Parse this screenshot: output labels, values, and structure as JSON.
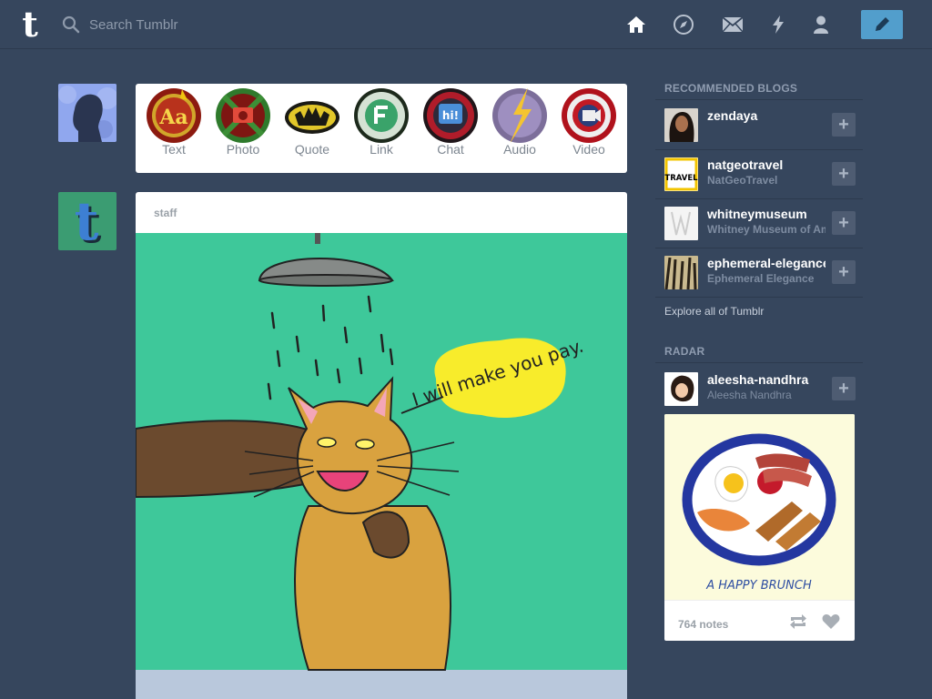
{
  "header": {
    "logo_letter": "t",
    "search_placeholder": "Search Tumblr",
    "nav_icons": [
      "home-icon",
      "explore-compass-icon",
      "inbox-mail-icon",
      "activity-lightning-icon",
      "account-person-icon"
    ],
    "compose_icon": "pencil-icon",
    "accent_color": "#529ecc",
    "background_color": "#36465d"
  },
  "post_types": [
    {
      "label": "Text"
    },
    {
      "label": "Photo"
    },
    {
      "label": "Quote"
    },
    {
      "label": "Link"
    },
    {
      "label": "Chat",
      "badge": "hi!"
    },
    {
      "label": "Audio"
    },
    {
      "label": "Video"
    }
  ],
  "post": {
    "author": "staff",
    "speech_bubble": "I will make you pay."
  },
  "sidebar": {
    "recommended_heading": "RECOMMENDED BLOGS",
    "blogs": [
      {
        "name": "zendaya",
        "title": ""
      },
      {
        "name": "natgeotravel",
        "title": "NatGeoTravel",
        "avatar_text": "TRAVEL"
      },
      {
        "name": "whitneymuseum",
        "title": "Whitney Museum of American Art"
      },
      {
        "name": "ephemeral-elegance",
        "title": "Ephemeral Elegance"
      }
    ],
    "follow_symbol": "+",
    "explore_link": "Explore all of Tumblr",
    "radar_heading": "RADAR",
    "radar": {
      "name": "aleesha-nandhra",
      "title": "Aleesha Nandhra",
      "image_caption": "A HAPPY BRUNCH",
      "notes": "764 notes"
    }
  }
}
